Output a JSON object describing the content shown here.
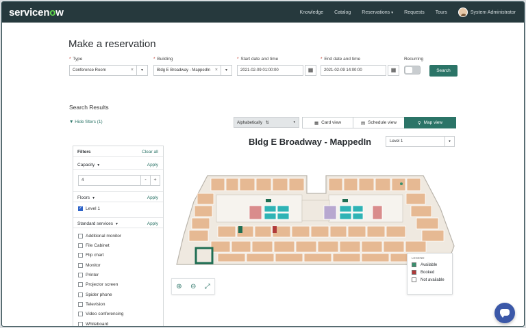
{
  "app": {
    "logo_text": "servicenow",
    "nav": [
      "Knowledge",
      "Catalog",
      "Reservations",
      "Requests",
      "Tours"
    ],
    "user_name": "System Administrator"
  },
  "page": {
    "title": "Make a reservation"
  },
  "form": {
    "type_label": "Type",
    "type_value": "Conference Room",
    "building_label": "Building",
    "building_value": "Bldg E Broadway - MappedIn",
    "start_label": "Start date and time",
    "start_value": "2021-02-09 01:00:00",
    "end_label": "End date and time",
    "end_value": "2021-02-09 14:00:00",
    "recurring_label": "Recurring",
    "recurring_on": false,
    "search_label": "Search"
  },
  "results": {
    "heading": "Search Results",
    "hide_filters": "Hide filters (1)",
    "sort_value": "Alphabetically",
    "views": [
      "Card view",
      "Schedule view",
      "Map view"
    ],
    "active_view": "Map view"
  },
  "map": {
    "title": "Bldg E Broadway - MappedIn",
    "level_value": "Level 1"
  },
  "filters": {
    "title": "Filters",
    "clear_all": "Clear all",
    "capacity_label": "Capacity",
    "capacity_value": "4",
    "apply": "Apply",
    "floors_label": "Floors",
    "floor_option": "Level 1",
    "services_label": "Standard services",
    "services": [
      "Additional monitor",
      "File Cabinet",
      "Flip chart",
      "Monitor",
      "Printer",
      "Projector screen",
      "Spider phone",
      "Television",
      "Video conferencing",
      "Whiteboard"
    ]
  },
  "legend": {
    "heading": "LEGEND",
    "items": [
      "Available",
      "Booked",
      "Not available"
    ],
    "colors": [
      "#3a8f6e",
      "#b03a3a",
      "#ffffff"
    ]
  },
  "colors": {
    "accent": "#2b7467",
    "topbar": "#26393d"
  }
}
